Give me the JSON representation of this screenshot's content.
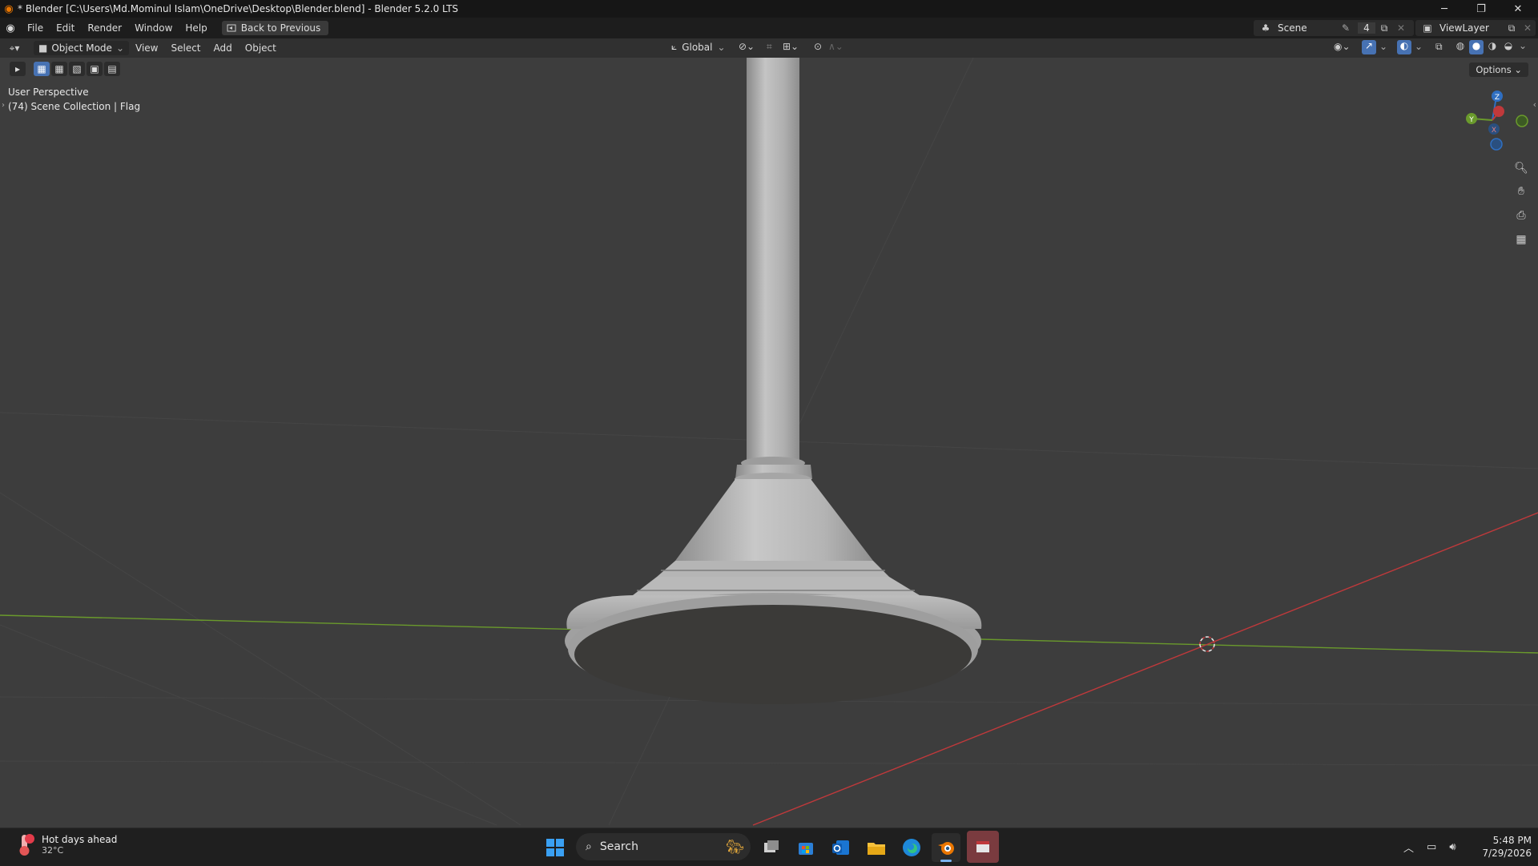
{
  "window": {
    "title": "* Blender [C:\\Users\\Md.Mominul Islam\\OneDrive\\Desktop\\Blender.blend] - Blender 5.2.0 LTS",
    "controls": {
      "minimize": "─",
      "restore": "❐",
      "close": "✕"
    }
  },
  "menubar": {
    "items": [
      "File",
      "Edit",
      "Render",
      "Window",
      "Help"
    ],
    "back_button": "Back to Previous",
    "scene_label": "Scene",
    "scene_count": "4",
    "view_layer_label": "ViewLayer"
  },
  "viewport_header": {
    "mode": "Object Mode",
    "menus": [
      "View",
      "Select",
      "Add",
      "Object"
    ],
    "transform_orientation": "Global",
    "options_label": "Options"
  },
  "viewport": {
    "perspective_label": "User Perspective",
    "collection_label": "(74) Scene Collection | Flag",
    "gizmo_axes": {
      "x": "X",
      "y": "Y",
      "z": "Z"
    },
    "colors": {
      "background": "#3d3d3d",
      "x_axis": "#c0393b",
      "y_axis": "#6a9a2c",
      "z_axis": "#2f6fc2",
      "mesh": "#a9a9a9",
      "selection": "#4772b3"
    }
  },
  "taskbar": {
    "weather_title": "Hot days ahead",
    "weather_temp": "32°C",
    "search_placeholder": "Search",
    "time": "5:48 PM",
    "date": "7/29/2026",
    "apps": [
      "start-icon",
      "task-view-icon",
      "store-icon",
      "outlook-icon",
      "file-explorer-icon",
      "edge-icon",
      "blender-icon",
      "app-icon"
    ]
  }
}
